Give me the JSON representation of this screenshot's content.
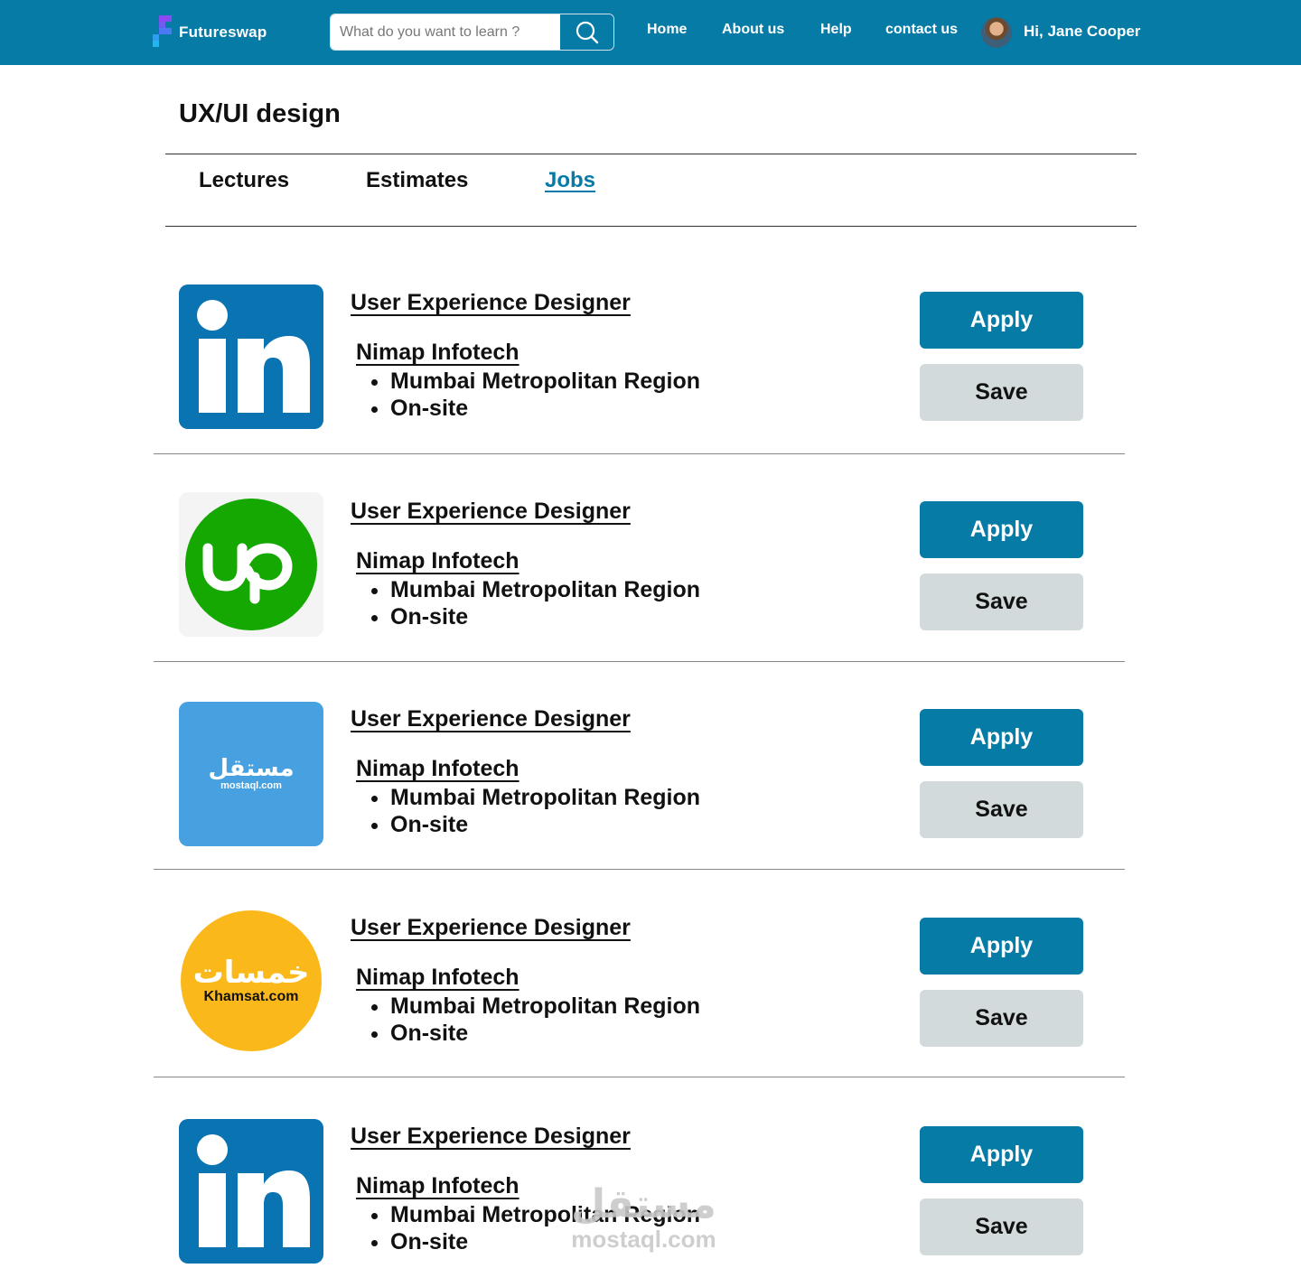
{
  "header": {
    "brand": "Futureswap",
    "search_placeholder": "What do you want to learn ?",
    "nav": [
      "Home",
      "About us",
      "Help",
      "contact us"
    ],
    "greeting": "Hi, Jane Cooper",
    "colors": {
      "bar": "#057ba6"
    }
  },
  "page": {
    "title": "UX/UI design",
    "tabs": [
      "Lectures",
      "Estimates",
      "Jobs"
    ],
    "active_tab": "Jobs"
  },
  "jobs": [
    {
      "logo": "linkedin-logo",
      "title": "User Experience Designer",
      "company": "Nimap Infotech",
      "details": [
        "Mumbai Metropolitan Region",
        "On-site"
      ],
      "apply": "Apply",
      "save": "Save"
    },
    {
      "logo": "upwork-logo",
      "title": "User Experience Designer",
      "company": "Nimap Infotech",
      "details": [
        "Mumbai Metropolitan Region",
        "On-site"
      ],
      "apply": "Apply",
      "save": "Save"
    },
    {
      "logo": "mostaql-logo",
      "logo_text_ar": "مستقل",
      "logo_text": "mostaql.com",
      "title": "User Experience Designer",
      "company": "Nimap Infotech",
      "details": [
        "Mumbai Metropolitan Region",
        "On-site"
      ],
      "apply": "Apply",
      "save": "Save"
    },
    {
      "logo": "khamsat-logo",
      "logo_text_ar": "خمسات",
      "logo_text": "Khamsat.com",
      "title": "User Experience Designer",
      "company": "Nimap Infotech",
      "details": [
        "Mumbai Metropolitan Region",
        "On-site"
      ],
      "apply": "Apply",
      "save": "Save"
    },
    {
      "logo": "linkedin-logo",
      "title": "User Experience Designer",
      "company": "Nimap Infotech",
      "details": [
        "Mumbai Metropolitan Region",
        "On-site"
      ],
      "apply": "Apply",
      "save": "Save"
    }
  ],
  "watermark": {
    "arabic": "مستقل",
    "domain": "mostaql.com"
  }
}
